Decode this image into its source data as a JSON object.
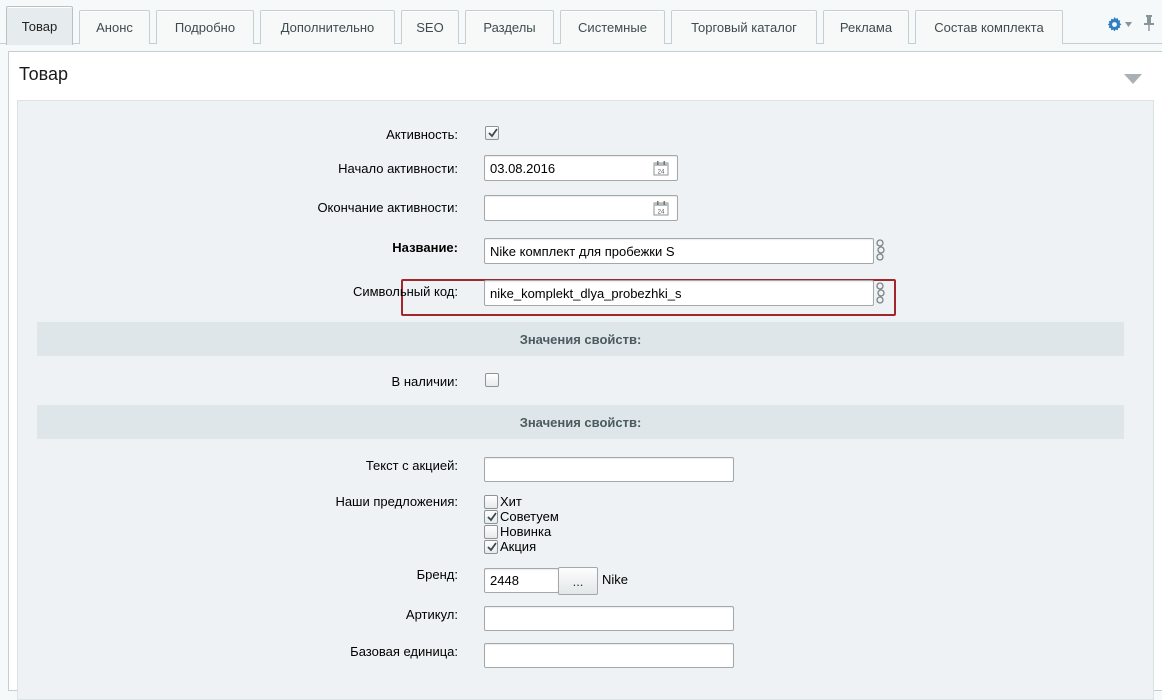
{
  "tabs": [
    {
      "label": "Товар",
      "active": true
    },
    {
      "label": "Анонс"
    },
    {
      "label": "Подробно"
    },
    {
      "label": "Дополнительно"
    },
    {
      "label": "SEO"
    },
    {
      "label": "Разделы"
    },
    {
      "label": "Системные"
    },
    {
      "label": "Торговый каталог"
    },
    {
      "label": "Реклама"
    },
    {
      "label": "Состав комплекта"
    }
  ],
  "panel": {
    "title": "Товар"
  },
  "form": {
    "active_label": "Активность:",
    "active_checked": true,
    "start_label": "Начало активности:",
    "start_value": "03.08.2016",
    "end_label": "Окончание активности:",
    "end_value": "",
    "name_label": "Название:",
    "name_value": "Nike комплект для пробежки S",
    "code_label": "Символьный код:",
    "code_value": "nike_komplekt_dlya_probezhki_s",
    "section1": "Значения свойств:",
    "in_stock_label": "В наличии:",
    "in_stock_checked": false,
    "section2": "Значения свойств:",
    "promo_label": "Текст с акцией:",
    "promo_value": "",
    "offers_label": "Наши предложения:",
    "offers": [
      {
        "label": "Хит",
        "checked": false
      },
      {
        "label": "Советуем",
        "checked": true
      },
      {
        "label": "Новинка",
        "checked": false
      },
      {
        "label": "Акция",
        "checked": true
      }
    ],
    "brand_label": "Бренд:",
    "brand_value": "2448",
    "brand_button": "...",
    "brand_name": "Nike",
    "article_label": "Артикул:",
    "article_value": "",
    "unit_label": "Базовая единица:",
    "unit_value": ""
  },
  "colors": {
    "highlight": "#a1262d",
    "accent_gear": "#2f7fc4"
  }
}
